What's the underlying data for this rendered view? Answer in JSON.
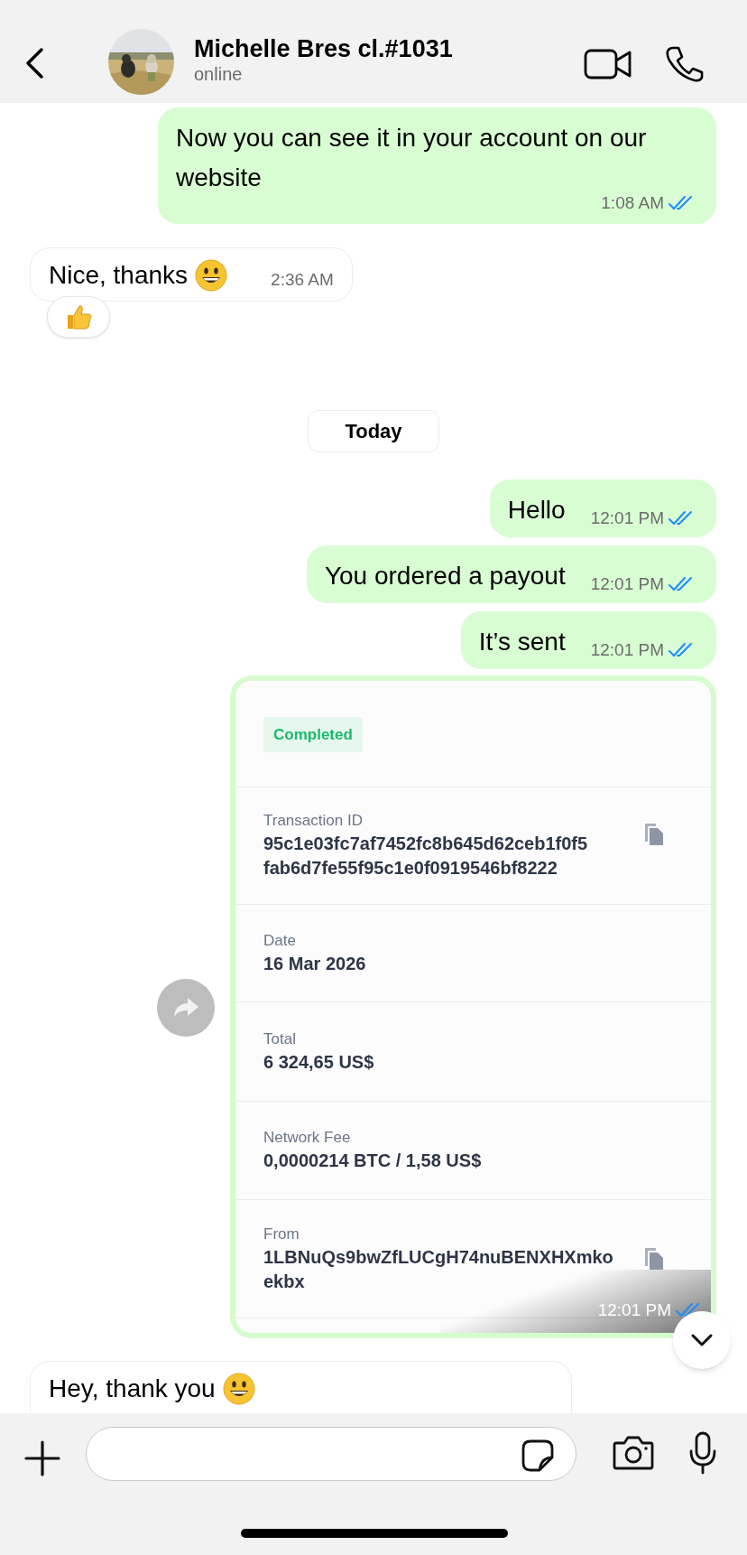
{
  "header": {
    "name": "Michelle Bres cl.#1031",
    "status": "online"
  },
  "messages": [
    {
      "kind": "outgoing",
      "text": "Now you can see it in your account on our website",
      "time": "1:08 AM",
      "read": true
    },
    {
      "kind": "incoming",
      "text": "Nice, thanks",
      "emoji": true,
      "time": "2:36 AM",
      "reacted": true
    },
    {
      "kind": "date",
      "text": "Today"
    },
    {
      "kind": "outgoing",
      "text": "Hello",
      "time": "12:01 PM",
      "read": true
    },
    {
      "kind": "outgoing",
      "text": "You ordered a payout",
      "time": "12:01 PM",
      "read": true
    },
    {
      "kind": "outgoing",
      "text": "It’s sent",
      "time": "12:01 PM",
      "read": true
    },
    {
      "kind": "transaction",
      "status": "Completed",
      "time": "12:01 PM",
      "read": true,
      "fields": [
        {
          "label": "Transaction ID",
          "value": "95c1e03fc7af7452fc8b645d62ceb1f0f5 fab6d7fe55f95c1e0f0919546bf8222",
          "copyable": true
        },
        {
          "label": "Date",
          "value": "16 Mar 2026",
          "copyable": false
        },
        {
          "label": "Total",
          "value": "6 324,65 US$",
          "copyable": false
        },
        {
          "label": "Network Fee",
          "value": "0,0000214 BTC / 1,58 US$",
          "copyable": false
        },
        {
          "label": "From",
          "value": "1LBNuQs9bwZfLUCgH74nuBENXHXmko ekbx",
          "copyable": true
        }
      ]
    },
    {
      "kind": "incoming",
      "text": "Hey, thank you",
      "emoji": true,
      "reacted": false
    }
  ]
}
